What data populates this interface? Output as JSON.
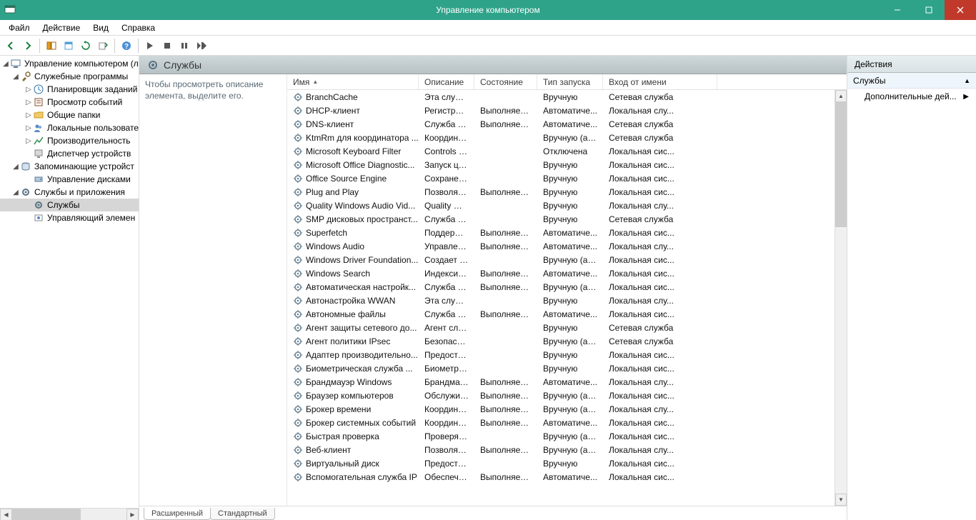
{
  "window": {
    "title": "Управление компьютером"
  },
  "menu": {
    "file": "Файл",
    "action": "Действие",
    "view": "Вид",
    "help": "Справка"
  },
  "tree": {
    "root": "Управление компьютером (л",
    "nodes": [
      {
        "label": "Служебные программы",
        "depth": 1,
        "exp": "◢",
        "icon": "tools"
      },
      {
        "label": "Планировщик заданий",
        "depth": 2,
        "exp": "▷",
        "icon": "clock"
      },
      {
        "label": "Просмотр событий",
        "depth": 2,
        "exp": "▷",
        "icon": "event"
      },
      {
        "label": "Общие папки",
        "depth": 2,
        "exp": "▷",
        "icon": "folder"
      },
      {
        "label": "Локальные пользовате",
        "depth": 2,
        "exp": "▷",
        "icon": "users"
      },
      {
        "label": "Производительность",
        "depth": 2,
        "exp": "▷",
        "icon": "perf"
      },
      {
        "label": "Диспетчер устройств",
        "depth": 2,
        "exp": "",
        "icon": "device"
      },
      {
        "label": "Запоминающие устройст",
        "depth": 1,
        "exp": "◢",
        "icon": "storage"
      },
      {
        "label": "Управление дисками",
        "depth": 2,
        "exp": "",
        "icon": "disk"
      },
      {
        "label": "Службы и приложения",
        "depth": 1,
        "exp": "◢",
        "icon": "services-app"
      },
      {
        "label": "Службы",
        "depth": 2,
        "exp": "",
        "icon": "services",
        "selected": true
      },
      {
        "label": "Управляющий элемен",
        "depth": 2,
        "exp": "",
        "icon": "wmi"
      }
    ]
  },
  "header": {
    "title": "Службы"
  },
  "description_hint": "Чтобы просмотреть описание элемента, выделите его.",
  "columns": {
    "name": "Имя",
    "desc": "Описание",
    "state": "Состояние",
    "start": "Тип запуска",
    "logon": "Вход от имени"
  },
  "services": [
    {
      "name": "BranchCache",
      "desc": "Эта служб...",
      "state": "",
      "start": "Вручную",
      "logon": "Сетевая служба"
    },
    {
      "name": "DHCP-клиент",
      "desc": "Регистрир...",
      "state": "Выполняется",
      "start": "Автоматиче...",
      "logon": "Локальная слу..."
    },
    {
      "name": "DNS-клиент",
      "desc": "Служба D...",
      "state": "Выполняется",
      "start": "Автоматиче...",
      "logon": "Сетевая служба"
    },
    {
      "name": "KtmRm для координатора ...",
      "desc": "Координи...",
      "state": "",
      "start": "Вручную (ак...",
      "logon": "Сетевая служба"
    },
    {
      "name": "Microsoft Keyboard Filter",
      "desc": "Controls k...",
      "state": "",
      "start": "Отключена",
      "logon": "Локальная сис..."
    },
    {
      "name": "Microsoft Office Diagnostic...",
      "desc": "Запуск це...",
      "state": "",
      "start": "Вручную",
      "logon": "Локальная сис..."
    },
    {
      "name": "Office Source Engine",
      "desc": "Сохранен...",
      "state": "",
      "start": "Вручную",
      "logon": "Локальная сис..."
    },
    {
      "name": "Plug and Play",
      "desc": "Позволяет...",
      "state": "Выполняется",
      "start": "Вручную",
      "logon": "Локальная сис..."
    },
    {
      "name": "Quality Windows Audio Vid...",
      "desc": "Quality Wi...",
      "state": "",
      "start": "Вручную",
      "logon": "Локальная слу..."
    },
    {
      "name": "SMP дисковых пространст...",
      "desc": "Служба уз...",
      "state": "",
      "start": "Вручную",
      "logon": "Сетевая служба"
    },
    {
      "name": "Superfetch",
      "desc": "Поддержи...",
      "state": "Выполняется",
      "start": "Автоматиче...",
      "logon": "Локальная сис..."
    },
    {
      "name": "Windows Audio",
      "desc": "Управлен...",
      "state": "Выполняется",
      "start": "Автоматиче...",
      "logon": "Локальная слу..."
    },
    {
      "name": "Windows Driver Foundation...",
      "desc": "Создает п...",
      "state": "",
      "start": "Вручную (ак...",
      "logon": "Локальная сис..."
    },
    {
      "name": "Windows Search",
      "desc": "Индексир...",
      "state": "Выполняется",
      "start": "Автоматиче...",
      "logon": "Локальная сис..."
    },
    {
      "name": "Автоматическая настройк...",
      "desc": "Служба ав...",
      "state": "Выполняется",
      "start": "Вручную (ак...",
      "logon": "Локальная сис..."
    },
    {
      "name": "Автонастройка WWAN",
      "desc": "Эта служб...",
      "state": "",
      "start": "Вручную",
      "logon": "Локальная слу..."
    },
    {
      "name": "Автономные файлы",
      "desc": "Служба ав...",
      "state": "Выполняется",
      "start": "Автоматиче...",
      "logon": "Локальная сис..."
    },
    {
      "name": "Агент защиты сетевого до...",
      "desc": "Агент слу...",
      "state": "",
      "start": "Вручную",
      "logon": "Сетевая служба"
    },
    {
      "name": "Агент политики IPsec",
      "desc": "Безопасно...",
      "state": "",
      "start": "Вручную (ак...",
      "logon": "Сетевая служба"
    },
    {
      "name": "Адаптер производительно...",
      "desc": "Предостав...",
      "state": "",
      "start": "Вручную",
      "logon": "Локальная сис..."
    },
    {
      "name": "Биометрическая служба ...",
      "desc": "Биометри...",
      "state": "",
      "start": "Вручную",
      "logon": "Локальная сис..."
    },
    {
      "name": "Брандмауэр Windows",
      "desc": "Брандмау...",
      "state": "Выполняется",
      "start": "Автоматиче...",
      "logon": "Локальная слу..."
    },
    {
      "name": "Браузер компьютеров",
      "desc": "Обслужив...",
      "state": "Выполняется",
      "start": "Вручную (ак...",
      "logon": "Локальная сис..."
    },
    {
      "name": "Брокер времени",
      "desc": "Координи...",
      "state": "Выполняется",
      "start": "Вручную (ак...",
      "logon": "Локальная слу..."
    },
    {
      "name": "Брокер системных событий",
      "desc": "Координи...",
      "state": "Выполняется",
      "start": "Автоматиче...",
      "logon": "Локальная сис..."
    },
    {
      "name": "Быстрая проверка",
      "desc": "Проверяет...",
      "state": "",
      "start": "Вручную (ак...",
      "logon": "Локальная сис..."
    },
    {
      "name": "Веб-клиент",
      "desc": "Позволяет...",
      "state": "Выполняется",
      "start": "Вручную (ак...",
      "logon": "Локальная слу..."
    },
    {
      "name": "Виртуальный диск",
      "desc": "Предостав...",
      "state": "",
      "start": "Вручную",
      "logon": "Локальная сис..."
    },
    {
      "name": "Вспомогательная служба IP",
      "desc": "Обеспечи...",
      "state": "Выполняется",
      "start": "Автоматиче...",
      "logon": "Локальная сис..."
    }
  ],
  "tabs": {
    "extended": "Расширенный",
    "standard": "Стандартный"
  },
  "actions": {
    "header": "Действия",
    "section": "Службы",
    "more": "Дополнительные дей..."
  }
}
